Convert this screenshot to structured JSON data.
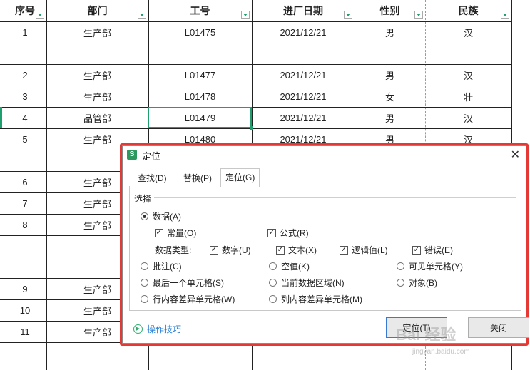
{
  "sheet": {
    "headers": [
      "序号",
      "部门",
      "工号",
      "进厂日期",
      "性别",
      "民族"
    ],
    "rows": [
      {
        "no": "1",
        "dept": "生产部",
        "id": "L01475",
        "date": "2021/12/21",
        "sex": "男",
        "eth": "汉"
      },
      {
        "no": "",
        "dept": "",
        "id": "",
        "date": "",
        "sex": "",
        "eth": ""
      },
      {
        "no": "2",
        "dept": "生产部",
        "id": "L01477",
        "date": "2021/12/21",
        "sex": "男",
        "eth": "汉"
      },
      {
        "no": "3",
        "dept": "生产部",
        "id": "L01478",
        "date": "2021/12/21",
        "sex": "女",
        "eth": "壮"
      },
      {
        "no": "4",
        "dept": "品管部",
        "id": "L01479",
        "date": "2021/12/21",
        "sex": "男",
        "eth": "汉"
      },
      {
        "no": "5",
        "dept": "生产部",
        "id": "L01480",
        "date": "2021/12/21",
        "sex": "男",
        "eth": "汉"
      },
      {
        "no": "",
        "dept": "",
        "id": "",
        "date": "",
        "sex": "",
        "eth": ""
      },
      {
        "no": "6",
        "dept": "生产部",
        "id": "",
        "date": "",
        "sex": "",
        "eth": ""
      },
      {
        "no": "7",
        "dept": "生产部",
        "id": "",
        "date": "",
        "sex": "",
        "eth": ""
      },
      {
        "no": "8",
        "dept": "生产部",
        "id": "",
        "date": "",
        "sex": "",
        "eth": ""
      },
      {
        "no": "",
        "dept": "",
        "id": "",
        "date": "",
        "sex": "",
        "eth": ""
      },
      {
        "no": "",
        "dept": "",
        "id": "",
        "date": "",
        "sex": "",
        "eth": ""
      },
      {
        "no": "9",
        "dept": "生产部",
        "id": "",
        "date": "",
        "sex": "",
        "eth": ""
      },
      {
        "no": "10",
        "dept": "生产部",
        "id": "",
        "date": "",
        "sex": "",
        "eth": ""
      },
      {
        "no": "11",
        "dept": "生产部",
        "id": "",
        "date": "",
        "sex": "",
        "eth": ""
      }
    ]
  },
  "dialog": {
    "icon_text": "S",
    "title": "定位",
    "close_glyph": "✕",
    "tabs": [
      "查找(D)",
      "替换(P)",
      "定位(G)"
    ],
    "group_label": "选择",
    "opt_data": "数据(A)",
    "chk_const": "常量(O)",
    "chk_formula": "公式(R)",
    "type_label": "数据类型:",
    "chk_number": "数字(U)",
    "chk_text": "文本(X)",
    "chk_logic": "逻辑值(L)",
    "chk_error": "错误(E)",
    "opt_comment": "批注(C)",
    "opt_blank": "空值(K)",
    "opt_visible": "可见单元格(Y)",
    "opt_last": "最后一个单元格(S)",
    "opt_region": "当前数据区域(N)",
    "opt_object": "对象(B)",
    "opt_rowdiff": "行内容差异单元格(W)",
    "opt_coldiff": "列内容差异单元格(M)",
    "tips": "操作技巧",
    "btn_locate": "定位(T)",
    "btn_close": "关闭"
  },
  "watermark": {
    "main": "Bai 经验",
    "sub": "jingyan.baidu.com"
  },
  "colors": {
    "highlight": "#e53935",
    "accent": "#1f9f6e",
    "link": "#2a7fd4"
  }
}
